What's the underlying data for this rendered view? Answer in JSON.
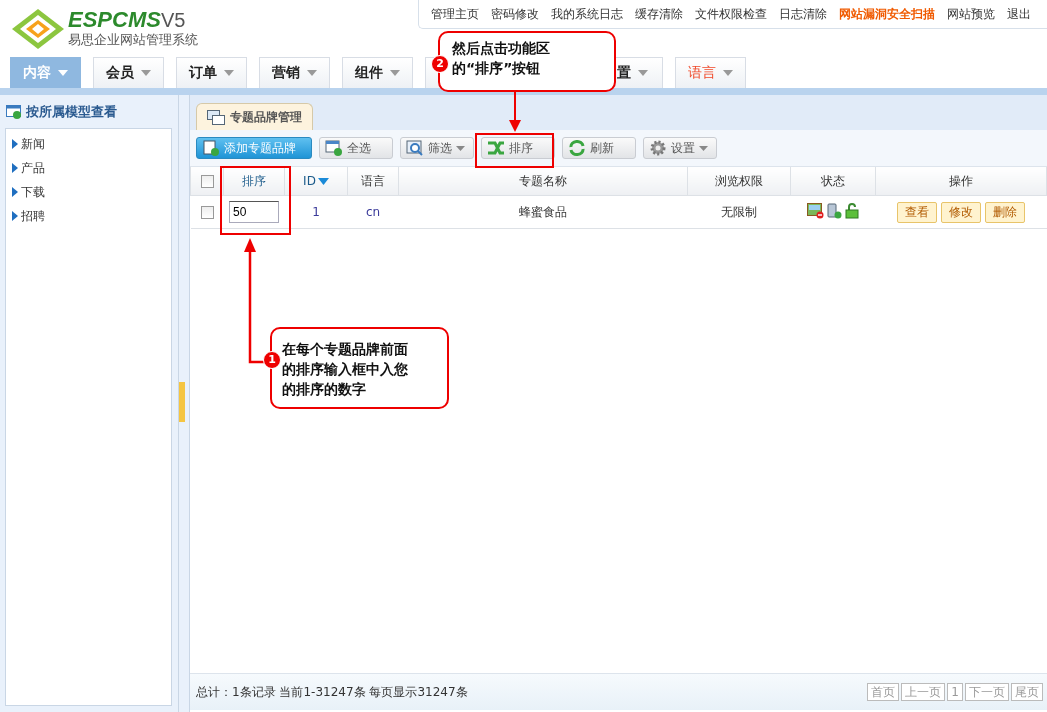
{
  "header": {
    "logo_text": "ESPCMS",
    "logo_version": "V5",
    "subtitle": "易思企业网站管理系统",
    "top_links": [
      {
        "label": "管理主页",
        "highlight": false
      },
      {
        "label": "密码修改",
        "highlight": false
      },
      {
        "label": "我的系统日志",
        "highlight": false
      },
      {
        "label": "缓存清除",
        "highlight": false
      },
      {
        "label": "文件权限检查",
        "highlight": false
      },
      {
        "label": "日志清除",
        "highlight": false
      },
      {
        "label": "网站漏洞安全扫描",
        "highlight": true
      },
      {
        "label": "网站预览",
        "highlight": false
      },
      {
        "label": "退出",
        "highlight": false
      }
    ]
  },
  "nav_tabs": [
    {
      "label": "内容",
      "selected": true,
      "highlight": false
    },
    {
      "label": "会员",
      "selected": false,
      "highlight": false
    },
    {
      "label": "订单",
      "selected": false,
      "highlight": false
    },
    {
      "label": "营销",
      "selected": false,
      "highlight": false
    },
    {
      "label": "组件",
      "selected": false,
      "highlight": false
    },
    {
      "label": "置",
      "selected": false,
      "highlight": false
    },
    {
      "label": "语言",
      "selected": false,
      "highlight": true
    }
  ],
  "sidebar": {
    "title": "按所属模型查看",
    "items": [
      "新闻",
      "产品",
      "下载",
      "招聘"
    ]
  },
  "panel_tab": "专题品牌管理",
  "toolbar": [
    {
      "label": "添加专题品牌",
      "kind": "add",
      "dropdown": false
    },
    {
      "label": "全选",
      "kind": "select",
      "dropdown": false
    },
    {
      "label": "筛选",
      "kind": "filter",
      "dropdown": true
    },
    {
      "label": "排序",
      "kind": "sort",
      "dropdown": false
    },
    {
      "label": "刷新",
      "kind": "refresh",
      "dropdown": false
    },
    {
      "label": "设置",
      "kind": "settings",
      "dropdown": true
    }
  ],
  "table": {
    "header_checked": false,
    "columns": [
      {
        "label": "排序",
        "sorted": false
      },
      {
        "label": "ID",
        "sorted": true
      },
      {
        "label": "语言",
        "sorted": false
      },
      {
        "label": "专题名称",
        "sorted": false
      },
      {
        "label": "浏览权限",
        "sorted": false
      },
      {
        "label": "状态",
        "sorted": false
      },
      {
        "label": "操作",
        "sorted": false
      }
    ],
    "rows": [
      {
        "checked": false,
        "order": "50",
        "id": "1",
        "lang": "cn",
        "name": "蜂蜜食品",
        "permission": "无限制",
        "actions": [
          "查看",
          "修改",
          "删除"
        ]
      }
    ]
  },
  "footer": {
    "summary": "总计：1条记录 当前1-31247条 每页显示31247条",
    "pager": [
      "首页",
      "上一页",
      "1",
      "下一页",
      "尾页"
    ]
  },
  "annotations": [
    {
      "number": "2",
      "text": "然后点击功能区的“排序”按钮"
    },
    {
      "number": "1",
      "text": "在每个专题品牌前面的排序输入框中入您的排序的数字"
    }
  ]
}
